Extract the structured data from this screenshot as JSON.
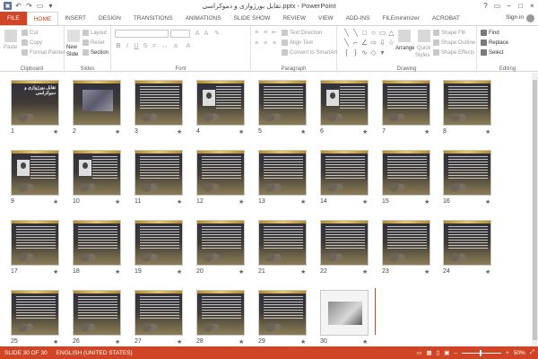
{
  "app": {
    "title": "تقابل بورژوازی و دموکراسی.pptx - PowerPoint",
    "signin": "Sign in"
  },
  "window_controls": [
    "?",
    "▭",
    "–",
    "□",
    "×"
  ],
  "tabs": [
    "FILE",
    "HOME",
    "INSERT",
    "DESIGN",
    "TRANSITIONS",
    "ANIMATIONS",
    "SLIDE SHOW",
    "REVIEW",
    "VIEW",
    "ADD-INS",
    "FILEminimizer",
    "ACROBAT"
  ],
  "active_tab": "HOME",
  "ribbon": {
    "clipboard": {
      "label": "Clipboard",
      "paste": "Paste",
      "cut": "Cut",
      "copy": "Copy",
      "format_painter": "Format Painter"
    },
    "slides": {
      "label": "Slides",
      "new_slide": "New",
      "new_slide_2": "Slide",
      "layout": "Layout",
      "reset": "Reset",
      "section": "Section"
    },
    "font": {
      "label": "Font"
    },
    "paragraph": {
      "label": "Paragraph",
      "text_direction": "Text Direction",
      "align_text": "Align Text",
      "convert_smartart": "Convert to SmartArt"
    },
    "drawing": {
      "label": "Drawing",
      "arrange": "Arrange",
      "quick_styles": "Quick",
      "quick_styles_2": "Styles",
      "shape_fill": "Shape Fill",
      "shape_outline": "Shape Outline",
      "shape_effects": "Shape Effects"
    },
    "editing": {
      "label": "Editing",
      "find": "Find",
      "replace": "Replace",
      "select": "Select"
    }
  },
  "slides": [
    {
      "n": "1",
      "kind": "title",
      "title": "تقابل بورژوازی و دموکراسی"
    },
    {
      "n": "2",
      "kind": "crowd"
    },
    {
      "n": "3",
      "kind": "text"
    },
    {
      "n": "4",
      "kind": "photo"
    },
    {
      "n": "5",
      "kind": "text"
    },
    {
      "n": "6",
      "kind": "photo"
    },
    {
      "n": "7",
      "kind": "text"
    },
    {
      "n": "8",
      "kind": "text"
    },
    {
      "n": "9",
      "kind": "photo"
    },
    {
      "n": "10",
      "kind": "photo"
    },
    {
      "n": "11",
      "kind": "text"
    },
    {
      "n": "12",
      "kind": "text"
    },
    {
      "n": "13",
      "kind": "text"
    },
    {
      "n": "14",
      "kind": "text"
    },
    {
      "n": "15",
      "kind": "text"
    },
    {
      "n": "16",
      "kind": "text"
    },
    {
      "n": "17",
      "kind": "text"
    },
    {
      "n": "18",
      "kind": "text"
    },
    {
      "n": "19",
      "kind": "text"
    },
    {
      "n": "20",
      "kind": "text"
    },
    {
      "n": "21",
      "kind": "text"
    },
    {
      "n": "22",
      "kind": "text"
    },
    {
      "n": "23",
      "kind": "text"
    },
    {
      "n": "24",
      "kind": "text"
    },
    {
      "n": "25",
      "kind": "text"
    },
    {
      "n": "26",
      "kind": "text"
    },
    {
      "n": "27",
      "kind": "text"
    },
    {
      "n": "28",
      "kind": "text"
    },
    {
      "n": "29",
      "kind": "text"
    },
    {
      "n": "30",
      "kind": "laptop"
    }
  ],
  "star": "★",
  "status": {
    "slide_count": "SLIDE 30 OF 30",
    "language": "ENGLISH (UNITED STATES)",
    "zoom": "50%",
    "zoom_minus": "–",
    "zoom_plus": "+"
  },
  "colors": {
    "accent": "#d04525",
    "slide_bg_dark": "#2f3040",
    "slide_gold": "#e6c56c"
  }
}
